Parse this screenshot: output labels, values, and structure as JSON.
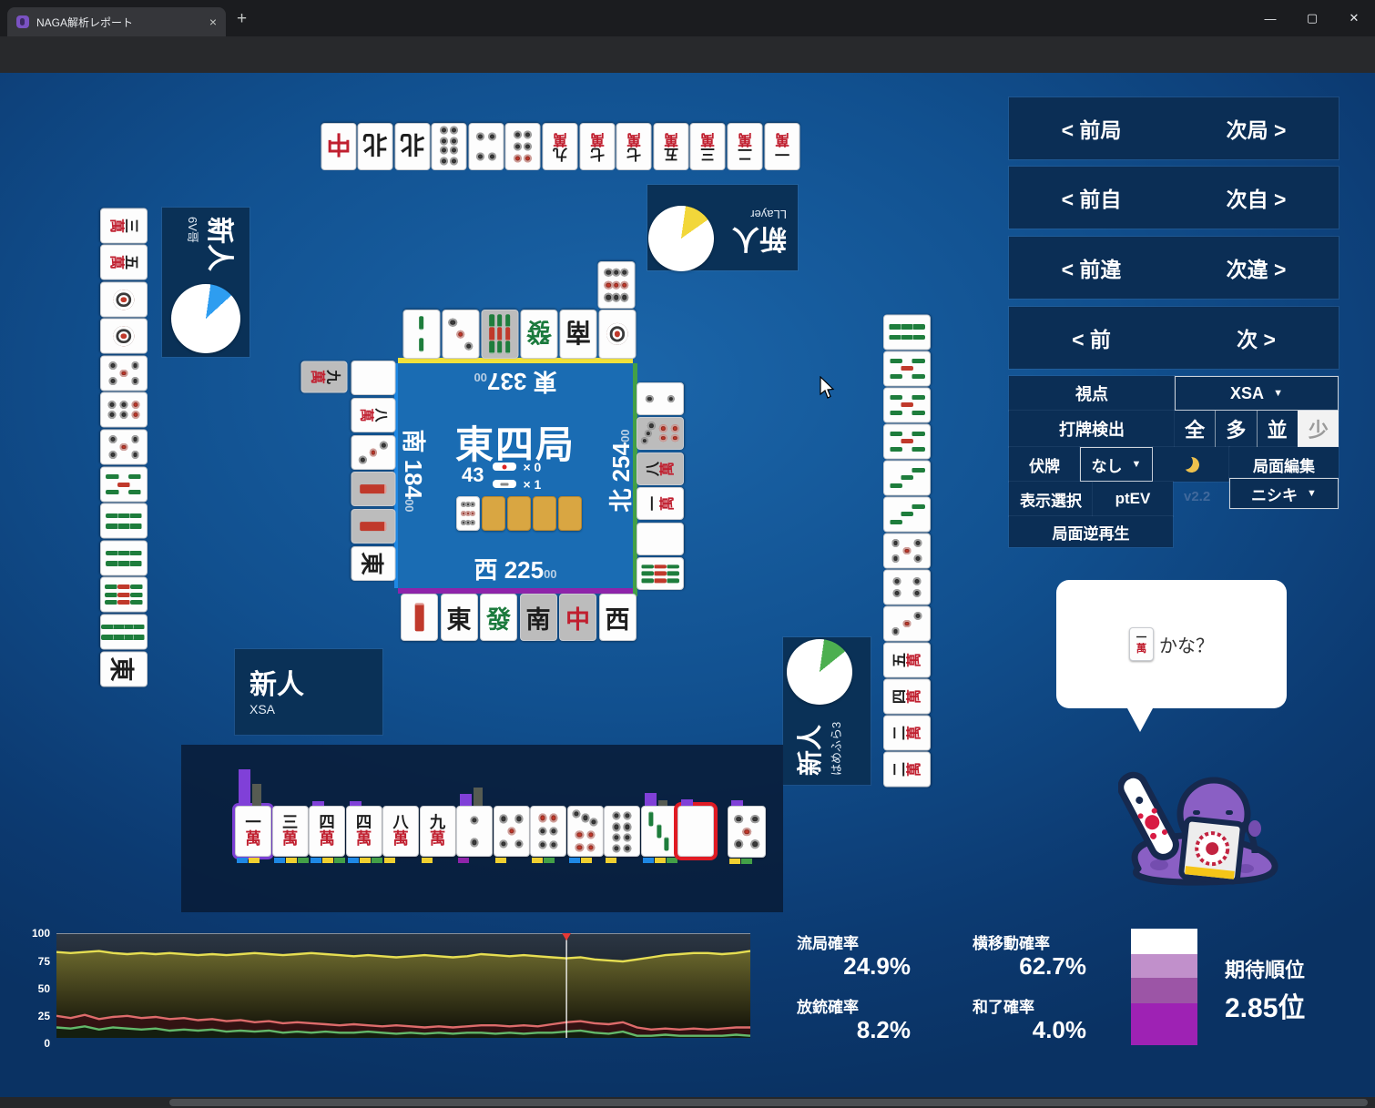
{
  "browser": {
    "tab_title": "NAGA解析レポート",
    "close_label": "×",
    "newtab_label": "+",
    "url": "https://naga.dmv.nico/htmls/6ee026ba42735d966bc96f458dbd9d1584d432d6c51f5dd6a069de232d0f0ec9v2_2.html?tw=0",
    "window": {
      "min": "—",
      "max": "▢",
      "close": "✕"
    }
  },
  "nav": {
    "rows": [
      {
        "l": "< 前局",
        "r": "次局 >"
      },
      {
        "l": "< 前自",
        "r": "次自 >"
      },
      {
        "l": "< 前違",
        "r": "次違 >"
      },
      {
        "l": "< 前",
        "r": "次 >"
      }
    ]
  },
  "settings": {
    "viewpoint_label": "視点",
    "viewpoint_value": "XSA",
    "dahai_label": "打牌検出",
    "dahai_options": [
      "全",
      "多",
      "並",
      "少"
    ],
    "dahai_selected": "少",
    "fusehai_label": "伏牌",
    "fusehai_value": "なし",
    "edit_label": "局面編集",
    "display_label": "表示選択",
    "display_value": "ptEV",
    "version": "v2.2",
    "model_value": "ニシキ",
    "reverse_label": "局面逆再生"
  },
  "players": {
    "top": {
      "rank": "新人",
      "name": "LLayer",
      "pie": {
        "color": "#f2d73a",
        "pct": 13
      }
    },
    "left": {
      "rank": "新人",
      "name": "6V哥",
      "pie": {
        "color": "#2e9df0",
        "pct": 11
      }
    },
    "right": {
      "rank": "新人",
      "name": "はめふら3",
      "pie": {
        "color": "#4caf50",
        "pct": 12
      }
    },
    "bottom": {
      "rank": "新人",
      "name": "XSA"
    }
  },
  "board": {
    "round": "東四局",
    "tiles_left": "43",
    "riichi_count": "× 0",
    "honba_count": "× 1",
    "seats": {
      "top": {
        "wind": "東",
        "score": "337",
        "sub": "00"
      },
      "left": {
        "wind": "南",
        "score": "184",
        "sub": "00"
      },
      "right": {
        "wind": "北",
        "score": "254",
        "sub": "00"
      },
      "bottom": {
        "wind": "西",
        "score": "225",
        "sub": "00"
      }
    },
    "dora_row": [
      "9p",
      "back",
      "back",
      "back",
      "back"
    ]
  },
  "discards": {
    "top_row": [
      "R",
      "N",
      "N",
      "8p",
      "4p",
      "6p",
      "9m",
      "7m",
      "7m",
      "5m",
      "3m",
      "2m",
      "1m"
    ],
    "left_col": [
      "3m",
      "5m",
      "1p",
      "1p",
      "5p",
      "6p",
      "5p",
      "5s",
      "6s",
      "6s",
      "9s",
      "8s",
      "E"
    ],
    "right_col": [
      "6s",
      "5s",
      "5s",
      "5s",
      "3s",
      "3s",
      "5p",
      "4p",
      "3p",
      "5m",
      "4m",
      "2m",
      "2m"
    ],
    "top_inner": [
      "2s",
      "3p",
      "9s*",
      "G",
      "S",
      "1p"
    ],
    "top_inner2": [
      "9p"
    ],
    "right_inner": [
      "2p",
      "7p*",
      "8m*",
      "1m",
      "Wh",
      "9s"
    ],
    "left_inner": [
      "Wh",
      "8m",
      "3p",
      "1s*",
      "1s*",
      "E"
    ],
    "left_inner_called": [
      "9m*"
    ],
    "bottom_inner": [
      "1s",
      "E",
      "G",
      "S*",
      "R*",
      "W"
    ]
  },
  "hand": {
    "tiles": [
      {
        "t": "1m",
        "sel": "purple",
        "pb": 40,
        "gb": 24,
        "marks": [
          "b",
          "y"
        ]
      },
      {
        "t": "3m",
        "pb": 0,
        "gb": 0,
        "marks": [
          "b",
          "y",
          "g"
        ]
      },
      {
        "t": "4m",
        "pb": 5,
        "gb": 0,
        "marks": [
          "b",
          "y",
          "g"
        ]
      },
      {
        "t": "4m",
        "pb": 5,
        "gb": 0,
        "marks": [
          "b",
          "y",
          "g"
        ]
      },
      {
        "t": "8m",
        "pb": 0,
        "gb": 0,
        "marks": [
          "y"
        ]
      },
      {
        "t": "9m",
        "pb": 0,
        "gb": 0,
        "marks": [
          "y"
        ]
      },
      {
        "t": "2p",
        "pb": 13,
        "gb": 20,
        "marks": [
          "p"
        ]
      },
      {
        "t": "5p",
        "pb": 0,
        "gb": 0,
        "marks": [
          "y"
        ]
      },
      {
        "t": "6p",
        "pb": 0,
        "gb": 0,
        "marks": [
          "y",
          "g"
        ]
      },
      {
        "t": "7p",
        "pb": 0,
        "gb": 0,
        "marks": [
          "b",
          "y"
        ]
      },
      {
        "t": "8p",
        "pb": 0,
        "gb": 0,
        "marks": [
          "y"
        ]
      },
      {
        "t": "3s",
        "pb": 14,
        "gb": 6,
        "marks": [
          "b",
          "y",
          "g"
        ]
      },
      {
        "t": "Wh",
        "sel": "red",
        "pb": 7,
        "gb": 0,
        "marks": []
      }
    ],
    "drawn": {
      "t": "5p",
      "pb": 6,
      "gb": 0,
      "marks": [
        "y",
        "g"
      ]
    }
  },
  "stats": [
    {
      "label": "流局確率",
      "value": "24.9%"
    },
    {
      "label": "横移動確率",
      "value": "62.7%"
    },
    {
      "label": "放銃確率",
      "value": "8.2%"
    },
    {
      "label": "和了確率",
      "value": "4.0%"
    }
  ],
  "rank": {
    "label": "期待順位",
    "value": "2.85位",
    "segments": [
      {
        "color": "#ffffff",
        "pct": 22
      },
      {
        "color": "#c190cb",
        "pct": 20
      },
      {
        "color": "#9c55a6",
        "pct": 22
      },
      {
        "color": "#9e22b4",
        "pct": 36
      }
    ]
  },
  "bubble": {
    "tile": "1m",
    "text": "かな？"
  },
  "chart_data": {
    "type": "line",
    "title": "",
    "xlabel": "",
    "ylabel": "",
    "ylim": [
      0,
      100
    ],
    "yticks": [
      0,
      25,
      50,
      75,
      100
    ],
    "grid": "top-line-only",
    "legend": "none",
    "marker_frac": 0.735,
    "series": [
      {
        "name": "tenpai-yellow",
        "color": "#e6de52",
        "values": [
          82,
          81,
          82,
          83,
          81,
          80,
          81,
          80,
          81,
          80,
          79,
          80,
          79,
          80,
          81,
          80,
          79,
          80,
          81,
          80,
          79,
          78,
          79,
          78,
          77,
          78,
          79,
          78,
          77,
          78,
          80,
          79,
          78,
          79,
          78,
          77,
          76,
          77,
          75,
          74,
          73,
          75,
          77,
          79,
          80,
          81,
          81,
          80,
          81,
          83
        ]
      },
      {
        "name": "deal-in-red",
        "color": "#dd6b6b",
        "values": [
          21,
          19,
          22,
          18,
          20,
          21,
          19,
          20,
          18,
          19,
          17,
          18,
          16,
          17,
          15,
          16,
          14,
          15,
          14,
          13,
          12,
          13,
          12,
          11,
          12,
          11,
          10,
          11,
          10,
          11,
          12,
          12,
          11,
          12,
          11,
          13,
          15,
          16,
          14,
          13,
          15,
          10,
          8,
          9,
          8,
          9,
          8,
          9,
          10,
          10
        ]
      },
      {
        "name": "win-green",
        "color": "#63b86a",
        "values": [
          10,
          9,
          11,
          8,
          10,
          9,
          8,
          9,
          7,
          8,
          7,
          8,
          6,
          7,
          6,
          7,
          5,
          6,
          5,
          6,
          5,
          5,
          6,
          5,
          4,
          5,
          4,
          5,
          4,
          5,
          5,
          4,
          5,
          4,
          5,
          5,
          6,
          7,
          5,
          4,
          6,
          2,
          2,
          3,
          2,
          2,
          2,
          2,
          3,
          2
        ]
      }
    ]
  }
}
